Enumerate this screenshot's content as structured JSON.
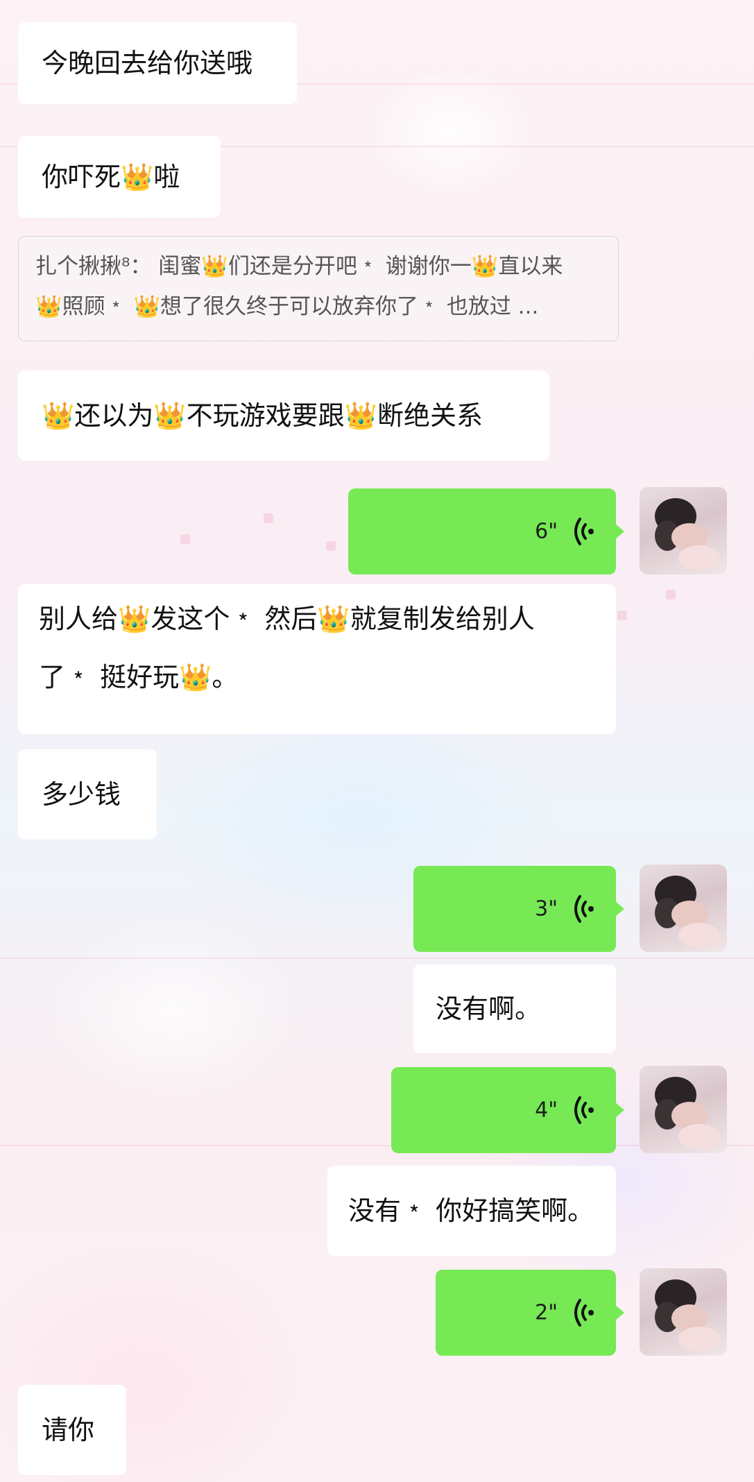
{
  "messages": [
    {
      "side": "left",
      "type": "text",
      "text": "今晚回去给你送哦"
    },
    {
      "side": "left",
      "type": "text",
      "text": "你吓死👑啦"
    },
    {
      "type": "quote",
      "line1": "扎个揪揪⁸： 闺蜜👑们还是分开吧﹡ 谢谢你一👑直以来",
      "line2": "👑照顾﹡ 👑想了很久终于可以放弃你了﹡ 也放过 ..."
    },
    {
      "side": "left",
      "type": "text",
      "text": "👑还以为👑不玩游戏要跟👑断绝关系"
    },
    {
      "side": "right",
      "type": "voice",
      "duration": "6\""
    },
    {
      "side": "left",
      "type": "text",
      "line1": "别人给👑发这个﹡ 然后👑就复制发给别人",
      "line2": "了﹡ 挺好玩👑。"
    },
    {
      "side": "left",
      "type": "text",
      "text": "多少钱"
    },
    {
      "side": "right",
      "type": "voice",
      "duration": "3\""
    },
    {
      "side": "right",
      "type": "text",
      "text": "没有啊。"
    },
    {
      "side": "right",
      "type": "voice",
      "duration": "4\""
    },
    {
      "side": "right",
      "type": "text",
      "text": "没有﹡ 你好搞笑啊。"
    },
    {
      "side": "right",
      "type": "voice",
      "duration": "2\""
    },
    {
      "side": "left",
      "type": "text",
      "text": "请你"
    }
  ],
  "icons": {
    "voice": "voice-wave-icon",
    "avatar": "user-avatar",
    "emoji": "crown-emoji"
  },
  "colors": {
    "voice_bubble": "#76e955",
    "text_bubble": "#ffffff",
    "text": "#111111"
  }
}
